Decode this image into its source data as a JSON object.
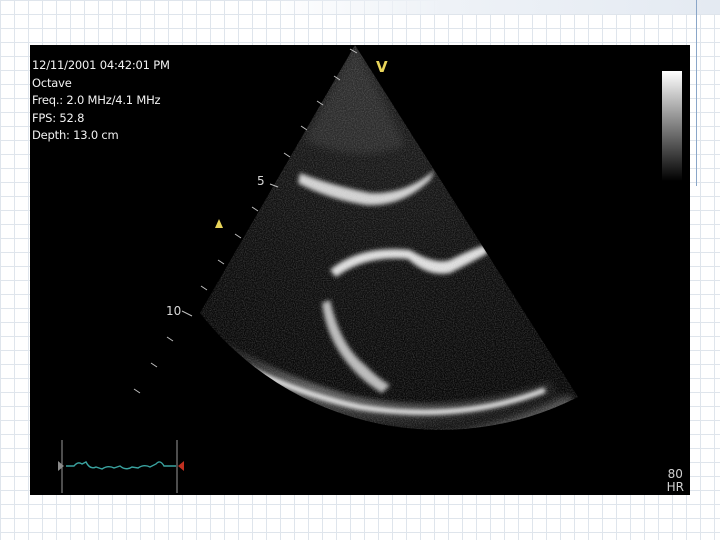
{
  "overlay": {
    "date_time": "12/11/2001 04:42:01 PM",
    "mode": "Octave",
    "frequency": "Freq.: 2.0 MHz/4.1 MHz",
    "fps": "FPS: 52.8",
    "depth": "Depth: 13.0 cm"
  },
  "probe_mark": "V",
  "depth_marks": [
    "5",
    "10"
  ],
  "heart_rate": {
    "value": "80",
    "unit": "HR"
  },
  "colors": {
    "overlay_text": "#f2f2f2",
    "marker_yellow": "#e8d45a",
    "ecg_trace": "#3aa3a0",
    "ecg_marker_red": "#c03020",
    "screen_bg": "#000000"
  },
  "icons": {
    "orientation_marker": "triangle-marker-icon",
    "ecg_start_marker": "triangle-right-icon",
    "ecg_end_marker": "triangle-left-icon"
  }
}
